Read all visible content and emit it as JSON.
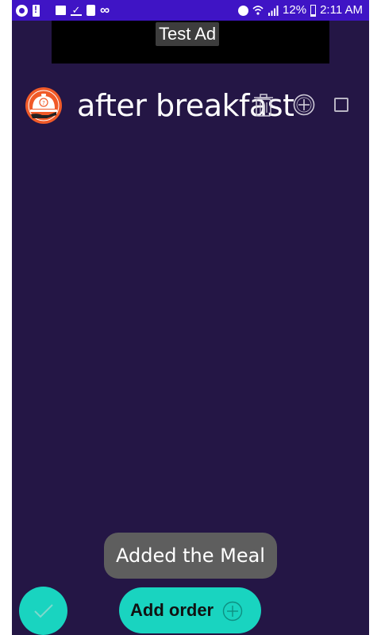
{
  "status_bar": {
    "battery_percent": "12%",
    "time": "2:11 AM",
    "left_icons": [
      "whatsapp-icon",
      "battery-alert-icon",
      "image-icon",
      "download-done-icon",
      "sim-icon",
      "infinity-icon"
    ],
    "right_icons": [
      "alarm-icon",
      "wifi-icon",
      "signal-icon",
      "battery-icon"
    ]
  },
  "ad": {
    "label": "Test Ad"
  },
  "meal": {
    "title": "after breakfast",
    "checked": false
  },
  "toast": {
    "message": "Added the Meal"
  },
  "actions": {
    "add_order_label": "Add order"
  },
  "colors": {
    "status_bar": "#3f14c5",
    "background": "#241645",
    "accent": "#19d4c0",
    "logo_orange": "#f05a28",
    "toast": "#5e5e5e"
  }
}
